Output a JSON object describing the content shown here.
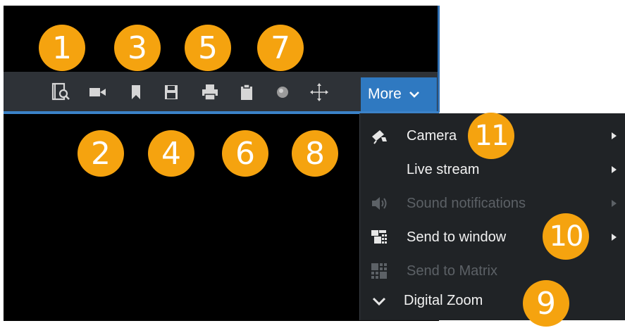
{
  "toolbar": {
    "more_label": "More",
    "icons": [
      "playback-search-icon",
      "camera-icon",
      "bookmark-icon",
      "save-icon",
      "print-icon",
      "clipboard-icon",
      "record-icon",
      "move-icon"
    ]
  },
  "menu": {
    "items": [
      {
        "label": "Camera",
        "icon": "camera-pin-icon",
        "enabled": true,
        "has_submenu": true
      },
      {
        "label": "Live stream",
        "icon": "",
        "enabled": true,
        "has_submenu": true
      },
      {
        "label": "Sound notifications",
        "icon": "speaker-icon",
        "enabled": false,
        "has_submenu": true
      },
      {
        "label": "Send to window",
        "icon": "window-layout-icon",
        "enabled": true,
        "has_submenu": true
      },
      {
        "label": "Send to Matrix",
        "icon": "matrix-grid-icon",
        "enabled": false,
        "has_submenu": false
      },
      {
        "label": "Digital Zoom",
        "icon": "checkmark-icon",
        "enabled": true,
        "has_submenu": false
      }
    ]
  },
  "callouts": [
    "1",
    "2",
    "3",
    "4",
    "5",
    "6",
    "7",
    "8",
    "9",
    "10",
    "11"
  ],
  "colors": {
    "accent_blue": "#2f79c1",
    "callout_orange": "#f5a30f",
    "toolbar_bg": "#2e3237",
    "menu_bg": "#202326"
  }
}
